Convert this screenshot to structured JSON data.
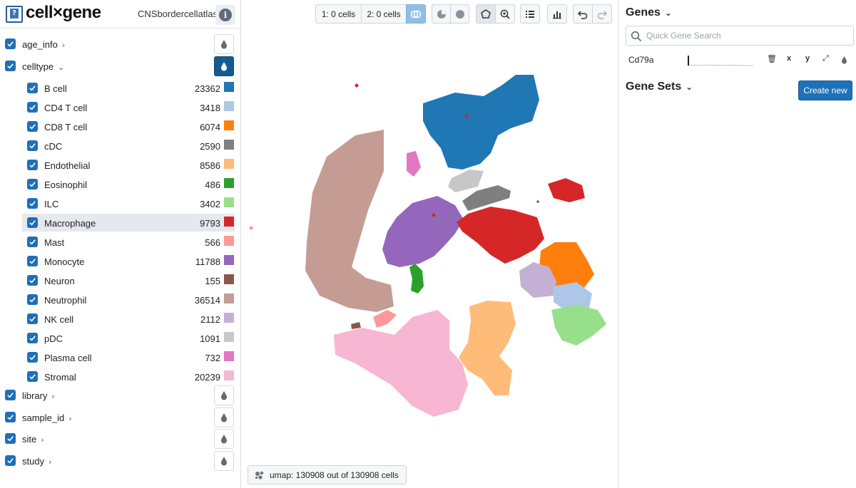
{
  "header": {
    "app_title": "cell×gene",
    "dataset_name": "CNSbordercellatlas",
    "info_label": "i"
  },
  "categories": {
    "age_info": "age_info",
    "celltype": "celltype",
    "library": "library",
    "sample_id": "sample_id",
    "site": "site",
    "study": "study"
  },
  "celltypes": [
    {
      "label": "B cell",
      "count": "23362",
      "color": "#1f77b4"
    },
    {
      "label": "CD4 T cell",
      "count": "3418",
      "color": "#aec7e8"
    },
    {
      "label": "CD8 T cell",
      "count": "6074",
      "color": "#ff7f0e"
    },
    {
      "label": "cDC",
      "count": "2590",
      "color": "#7f7f7f"
    },
    {
      "label": "Endothelial",
      "count": "8586",
      "color": "#ffbb78"
    },
    {
      "label": "Eosinophil",
      "count": "486",
      "color": "#2ca02c"
    },
    {
      "label": "ILC",
      "count": "3402",
      "color": "#98df8a"
    },
    {
      "label": "Macrophage",
      "count": "9793",
      "color": "#d62728"
    },
    {
      "label": "Mast",
      "count": "566",
      "color": "#ff9896"
    },
    {
      "label": "Monocyte",
      "count": "11788",
      "color": "#9467bd"
    },
    {
      "label": "Neuron",
      "count": "155",
      "color": "#8c564b"
    },
    {
      "label": "Neutrophil",
      "count": "36514",
      "color": "#c49c94"
    },
    {
      "label": "NK cell",
      "count": "2112",
      "color": "#c5b0d5"
    },
    {
      "label": "pDC",
      "count": "1091",
      "color": "#c7c7c7"
    },
    {
      "label": "Plasma cell",
      "count": "732",
      "color": "#e377c2"
    },
    {
      "label": "Stromal",
      "count": "20239",
      "color": "#f7b6d2"
    }
  ],
  "toolbar": {
    "cellset1": "1: 0 cells",
    "cellset2": "2: 0 cells"
  },
  "embedding": {
    "label": "umap: 130908 out of 130908 cells"
  },
  "right_panel": {
    "genes_title": "Genes",
    "search_placeholder": "Quick Gene Search",
    "gene_name": "Cd79a",
    "gene_x": "x",
    "gene_y": "y",
    "gene_sets_title": "Gene Sets",
    "create_new": "Create new"
  }
}
